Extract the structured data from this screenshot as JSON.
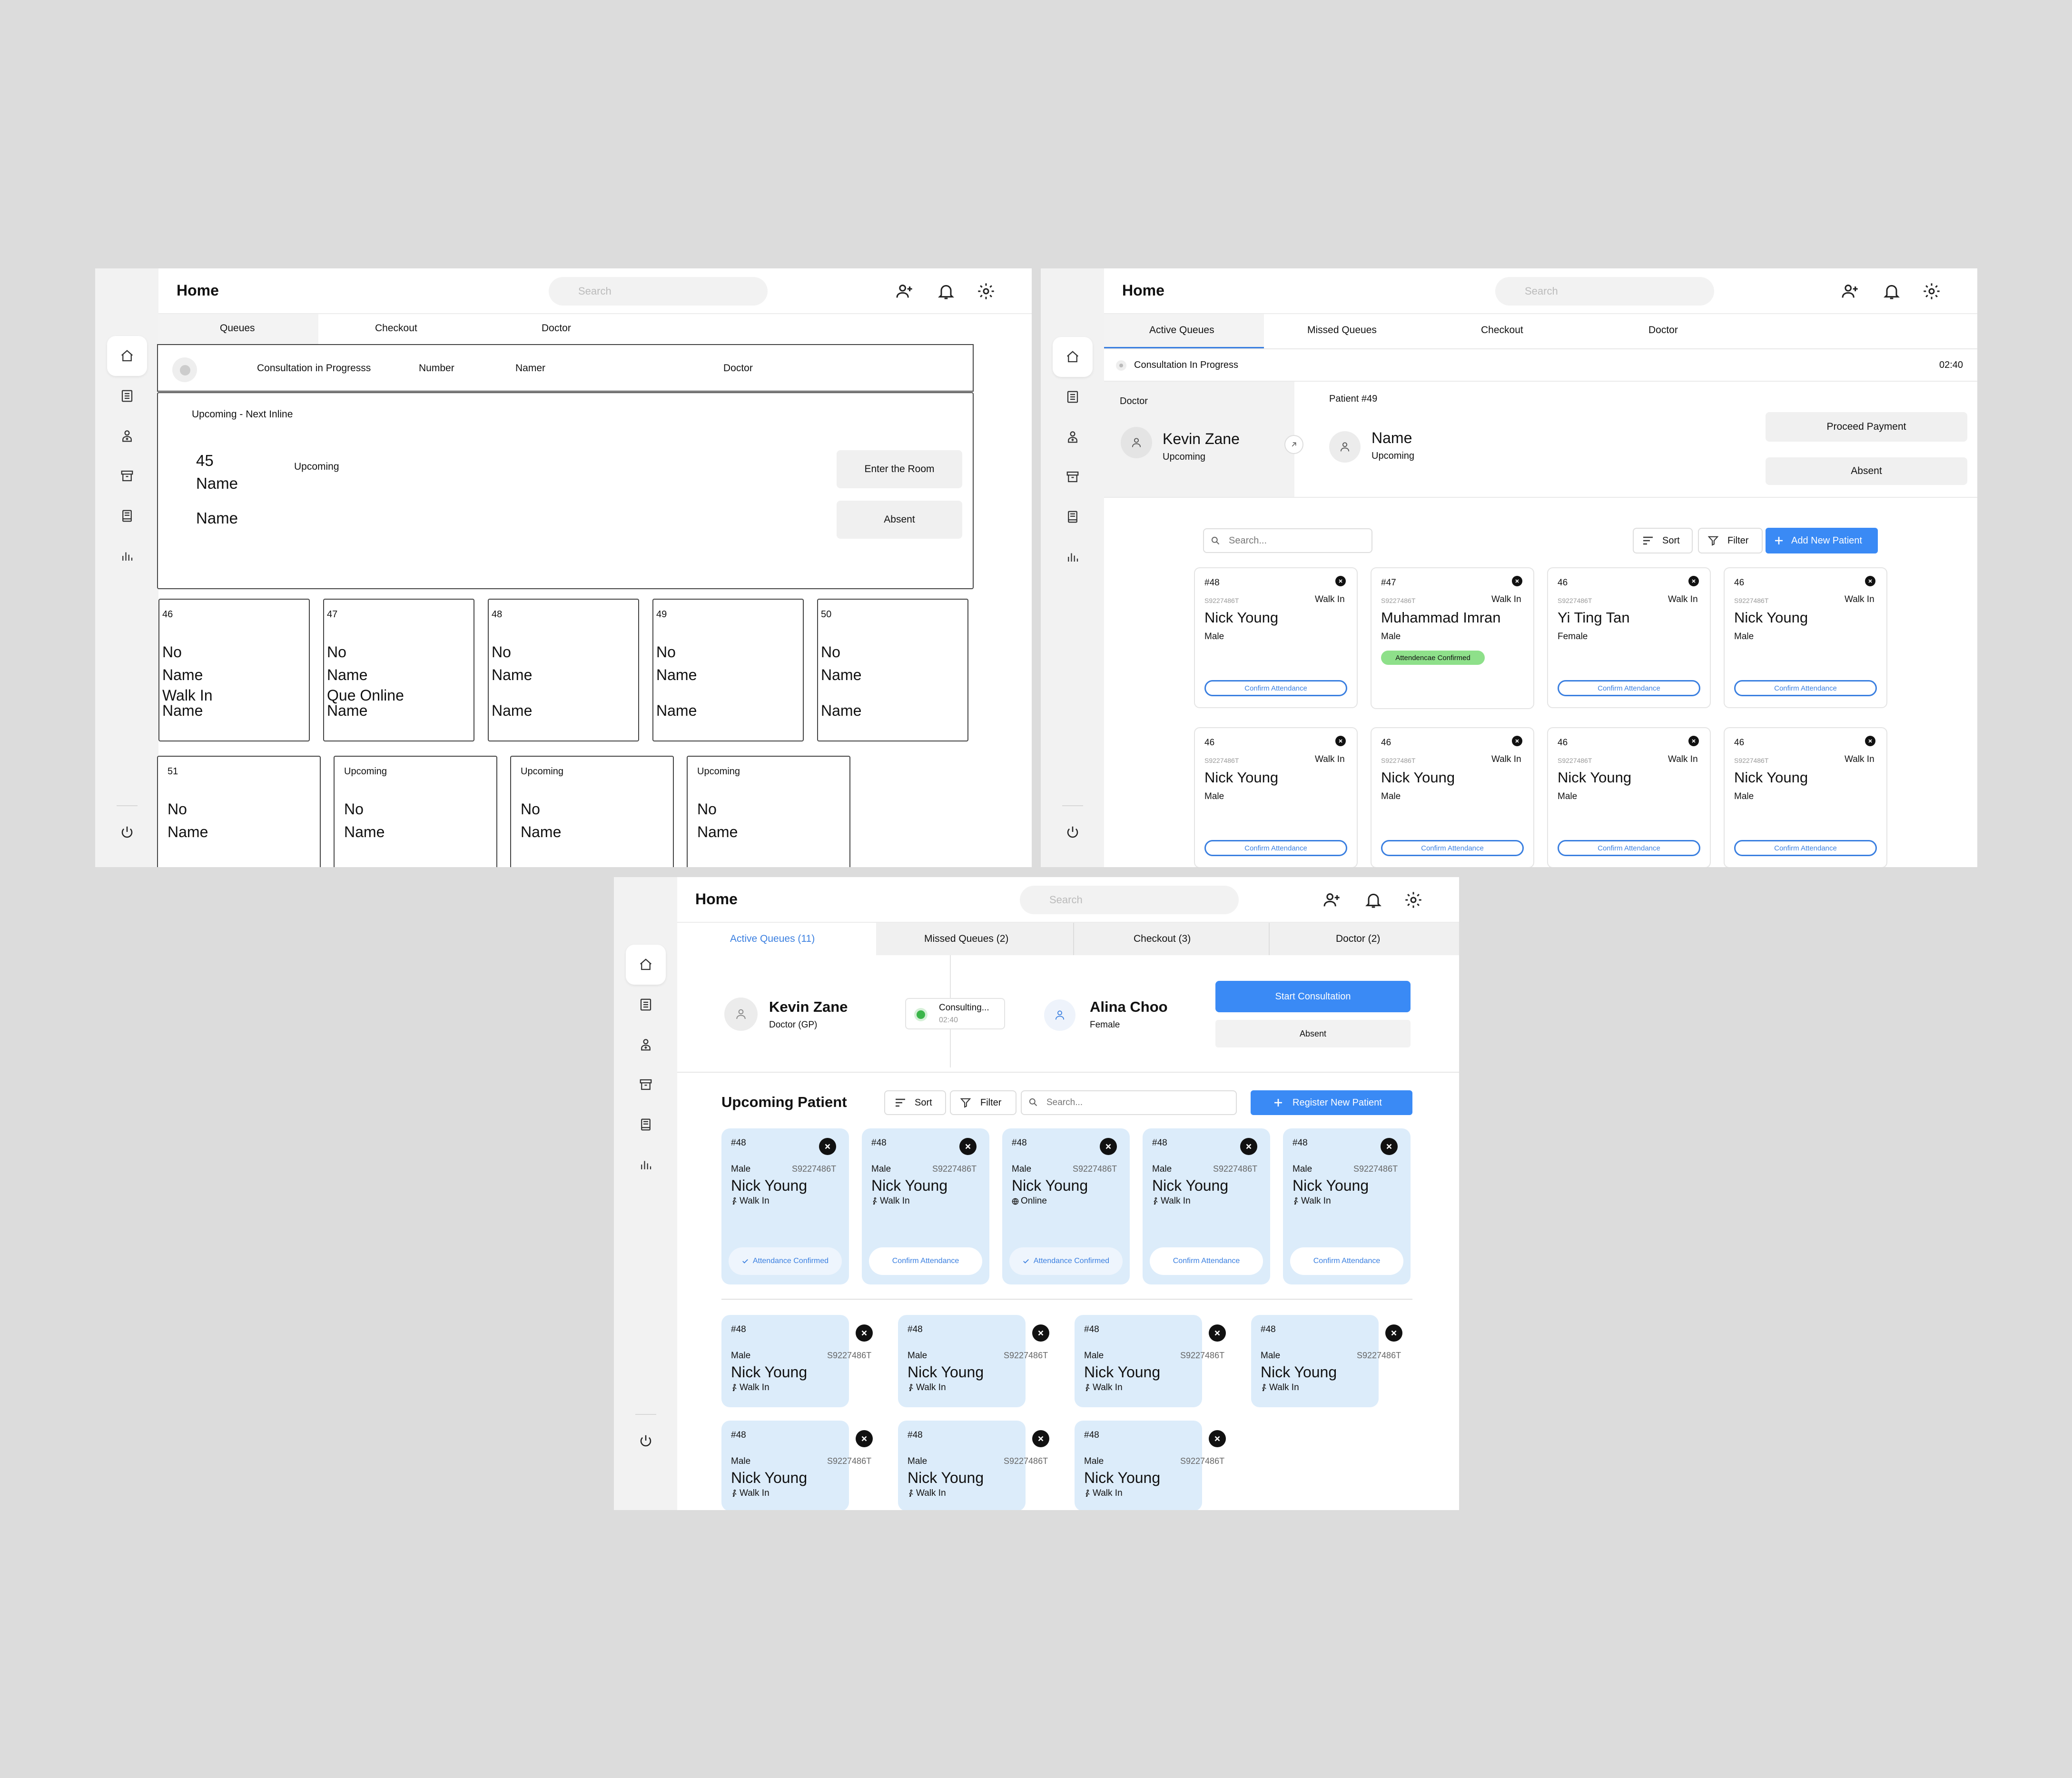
{
  "common": {
    "home_title": "Home",
    "search_placeholder": "Search"
  },
  "frame1": {
    "tabs": [
      "Queues",
      "Checkout",
      "Doctor"
    ],
    "consult_header": [
      "Consultation in Progresss",
      "Number",
      "Namer",
      "Doctor"
    ],
    "next_title": "Upcoming - Next Inline",
    "next_number": "45",
    "next_name1": "Name",
    "next_status": "Upcoming",
    "next_name2": "Name",
    "enter_room": "Enter the Room",
    "absent": "Absent",
    "row1": [
      {
        "num": "46",
        "l1": "No",
        "l2": "Name",
        "l3": "Walk In",
        "l4": "Name"
      },
      {
        "num": "47",
        "l1": "No",
        "l2": "Name",
        "l3": "Que Online",
        "l4": "Name"
      },
      {
        "num": "48",
        "l1": "No",
        "l2": "Name",
        "l3": "",
        "l4": "Name"
      },
      {
        "num": "49",
        "l1": "No",
        "l2": "Name",
        "l3": "",
        "l4": "Name"
      },
      {
        "num": "50",
        "l1": "No",
        "l2": "Name",
        "l3": "",
        "l4": "Name"
      }
    ],
    "row2": [
      {
        "num": "51",
        "l1": "No",
        "l2": "Name"
      },
      {
        "num": "Upcoming",
        "l1": "No",
        "l2": "Name"
      },
      {
        "num": "Upcoming",
        "l1": "No",
        "l2": "Name"
      },
      {
        "num": "Upcoming",
        "l1": "No",
        "l2": "Name"
      }
    ]
  },
  "frame2": {
    "tabs": [
      "Active Queues",
      "Missed Queues",
      "Checkout",
      "Doctor"
    ],
    "consult_label": "Consultation In Progress",
    "timer": "02:40",
    "doctor_label": "Doctor",
    "doctor_name": "Kevin Zane",
    "doctor_status": "Upcoming",
    "patient_label": "Patient #49",
    "patient_name": "Name",
    "patient_status": "Upcoming",
    "proceed_payment": "Proceed Payment",
    "absent": "Absent",
    "search_placeholder": "Search...",
    "sort": "Sort",
    "filter": "Filter",
    "add_patient": "Add New Patient",
    "confirm_label": "Confirm Attendance",
    "confirmed_label": "Attendencae Confirmed",
    "cards": [
      {
        "num": "#48",
        "id": "S9227486T",
        "type": "Walk In",
        "name": "Nick Young",
        "gender": "Male",
        "confirmed": false
      },
      {
        "num": "#47",
        "id": "S9227486T",
        "type": "Walk In",
        "name": "Muhammad Imran",
        "gender": "Male",
        "confirmed": true
      },
      {
        "num": "46",
        "id": "S9227486T",
        "type": "Walk In",
        "name": "Yi Ting Tan",
        "gender": "Female",
        "confirmed": false
      },
      {
        "num": "46",
        "id": "S9227486T",
        "type": "Walk In",
        "name": "Nick Young",
        "gender": "Male",
        "confirmed": false
      },
      {
        "num": "46",
        "id": "S9227486T",
        "type": "Walk In",
        "name": "Nick Young",
        "gender": "Male",
        "confirmed": false
      },
      {
        "num": "46",
        "id": "S9227486T",
        "type": "Walk In",
        "name": "Nick Young",
        "gender": "Male",
        "confirmed": false
      },
      {
        "num": "46",
        "id": "S9227486T",
        "type": "Walk In",
        "name": "Nick Young",
        "gender": "Male",
        "confirmed": false
      },
      {
        "num": "46",
        "id": "S9227486T",
        "type": "Walk In",
        "name": "Nick Young",
        "gender": "Male",
        "confirmed": false
      }
    ]
  },
  "frame3": {
    "tabs": [
      "Active Queues (11)",
      "Missed Queues (2)",
      "Checkout (3)",
      "Doctor (2)"
    ],
    "doctor_name": "Kevin Zane",
    "doctor_role": "Doctor (GP)",
    "consulting": "Consulting...",
    "timer": "02:40",
    "patient_name": "Alina Choo",
    "patient_gender": "Female",
    "start_consult": "Start Consultation",
    "absent": "Absent",
    "section_title": "Upcoming Patient",
    "sort": "Sort",
    "filter": "Filter",
    "search_placeholder": "Search...",
    "register": "Register New Patient",
    "confirm_label": "Confirm Attendance",
    "confirmed_label": "Attendance Confirmed",
    "top_cards": [
      {
        "num": "#48",
        "gender": "Male",
        "id": "S9227486T",
        "name": "Nick Young",
        "type": "Walk In",
        "confirmed": true
      },
      {
        "num": "#48",
        "gender": "Male",
        "id": "S9227486T",
        "name": "Nick Young",
        "type": "Walk In",
        "confirmed": false
      },
      {
        "num": "#48",
        "gender": "Male",
        "id": "S9227486T",
        "name": "Nick Young",
        "type": "Online",
        "confirmed": true
      },
      {
        "num": "#48",
        "gender": "Male",
        "id": "S9227486T",
        "name": "Nick Young",
        "type": "Walk In",
        "confirmed": false
      },
      {
        "num": "#48",
        "gender": "Male",
        "id": "S9227486T",
        "name": "Nick Young",
        "type": "Walk In",
        "confirmed": false
      }
    ],
    "bottom_cards": [
      {
        "num": "#48",
        "gender": "Male",
        "id": "S9227486T",
        "name": "Nick Young",
        "type": "Walk In"
      },
      {
        "num": "#48",
        "gender": "Male",
        "id": "S9227486T",
        "name": "Nick Young",
        "type": "Walk In"
      },
      {
        "num": "#48",
        "gender": "Male",
        "id": "S9227486T",
        "name": "Nick Young",
        "type": "Walk In"
      },
      {
        "num": "#48",
        "gender": "Male",
        "id": "S9227486T",
        "name": "Nick Young",
        "type": "Walk In"
      },
      {
        "num": "#48",
        "gender": "Male",
        "id": "S9227486T",
        "name": "Nick Young",
        "type": "Walk In"
      },
      {
        "num": "#48",
        "gender": "Male",
        "id": "S9227486T",
        "name": "Nick Young",
        "type": "Walk In"
      },
      {
        "num": "#48",
        "gender": "Male",
        "id": "S9227486T",
        "name": "Nick Young",
        "type": "Walk In"
      }
    ]
  },
  "colors": {
    "accent": "#3a8af5",
    "card_blue": "#dcecfa",
    "confirmed_green": "#8ee08a"
  }
}
